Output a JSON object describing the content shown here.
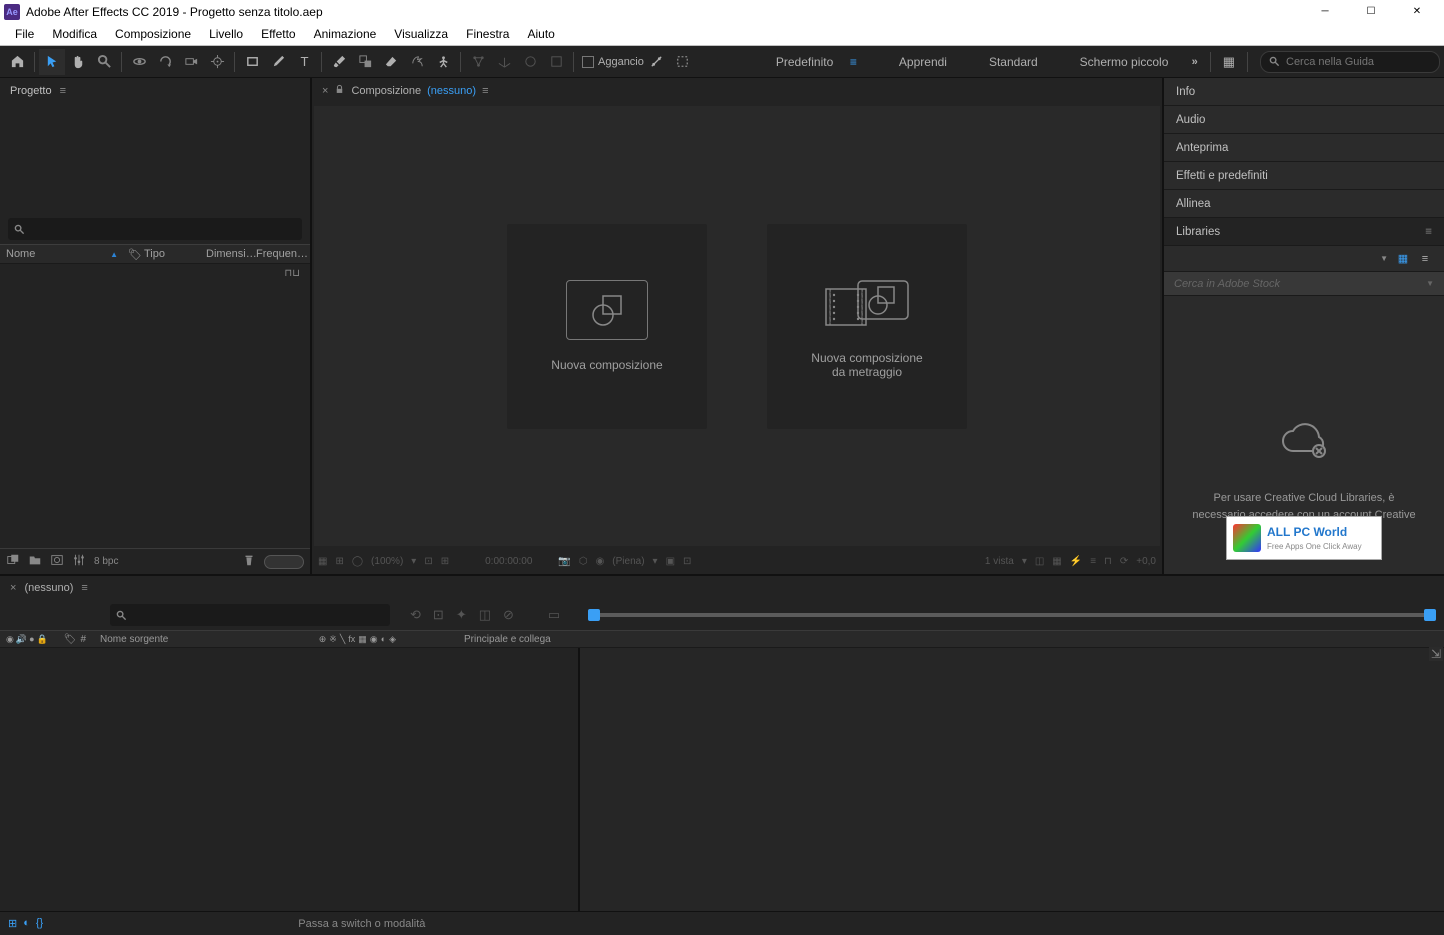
{
  "titlebar": {
    "title": "Adobe After Effects CC 2019 - Progetto senza titolo.aep"
  },
  "menubar": {
    "items": [
      "File",
      "Modifica",
      "Composizione",
      "Livello",
      "Effetto",
      "Animazione",
      "Visualizza",
      "Finestra",
      "Aiuto"
    ]
  },
  "toolbar": {
    "snap_label": "Aggancio",
    "workspaces": {
      "active": "Predefinito",
      "items": [
        "Predefinito",
        "Apprendi",
        "Standard",
        "Schermo piccolo"
      ]
    },
    "search_placeholder": "Cerca nella Guida"
  },
  "project": {
    "tab": "Progetto",
    "columns": {
      "name": "Nome",
      "type": "Tipo",
      "size": "Dimensi…",
      "freq": "Frequen…"
    },
    "bpc": "8 bpc"
  },
  "composition": {
    "tab_prefix": "Composizione",
    "none": "(nessuno)",
    "card1": "Nuova composizione",
    "card2_line1": "Nuova composizione",
    "card2_line2": "da metraggio",
    "footer": {
      "zoom": "(100%)",
      "time": "0:00:00:00",
      "piena": "(Piena)",
      "vista": "1 vista",
      "exposure": "+0,0"
    }
  },
  "rightpanels": {
    "items": [
      "Info",
      "Audio",
      "Anteprima",
      "Effetti e predefiniti",
      "Allinea"
    ],
    "libraries": "Libraries",
    "lib_search": "Cerca in Adobe Stock",
    "lib_message": "Per usare Creative Cloud Libraries, è necessario accedere con un account Creative Cloud.",
    "badge_title": "ALL PC World",
    "badge_sub": "Free Apps One Click Away"
  },
  "timeline": {
    "none": "(nessuno)",
    "name_col": "Nome sorgente",
    "parent_col": "Principale e collega"
  },
  "statusbar": {
    "msg": "Passa a switch o modalità"
  }
}
